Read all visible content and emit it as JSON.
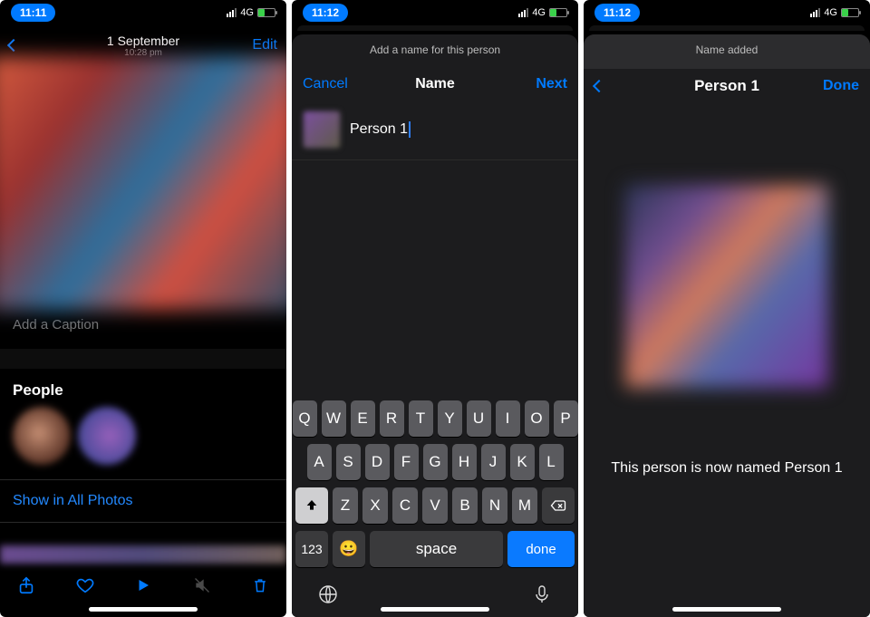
{
  "phone1": {
    "status": {
      "time": "11:11",
      "net": "4G"
    },
    "header": {
      "title": "1 September",
      "subtitle": "10:28 pm",
      "edit": "Edit"
    },
    "caption_placeholder": "Add a Caption",
    "people_label": "People",
    "show_all": "Show in All Photos"
  },
  "phone2": {
    "status": {
      "time": "11:12",
      "net": "4G"
    },
    "hint": "Add a name for this person",
    "nav": {
      "cancel": "Cancel",
      "title": "Name",
      "next": "Next"
    },
    "input_value": "Person 1",
    "keyboard": {
      "row1": [
        "Q",
        "W",
        "E",
        "R",
        "T",
        "Y",
        "U",
        "I",
        "O",
        "P"
      ],
      "row2": [
        "A",
        "S",
        "D",
        "F",
        "G",
        "H",
        "J",
        "K",
        "L"
      ],
      "row3": [
        "Z",
        "X",
        "C",
        "V",
        "B",
        "N",
        "M"
      ],
      "num": "123",
      "space": "space",
      "done": "done"
    }
  },
  "phone3": {
    "status": {
      "time": "11:12",
      "net": "4G"
    },
    "hint": "Name added",
    "nav": {
      "title": "Person 1",
      "done": "Done"
    },
    "result": "This person is now named Person 1"
  }
}
